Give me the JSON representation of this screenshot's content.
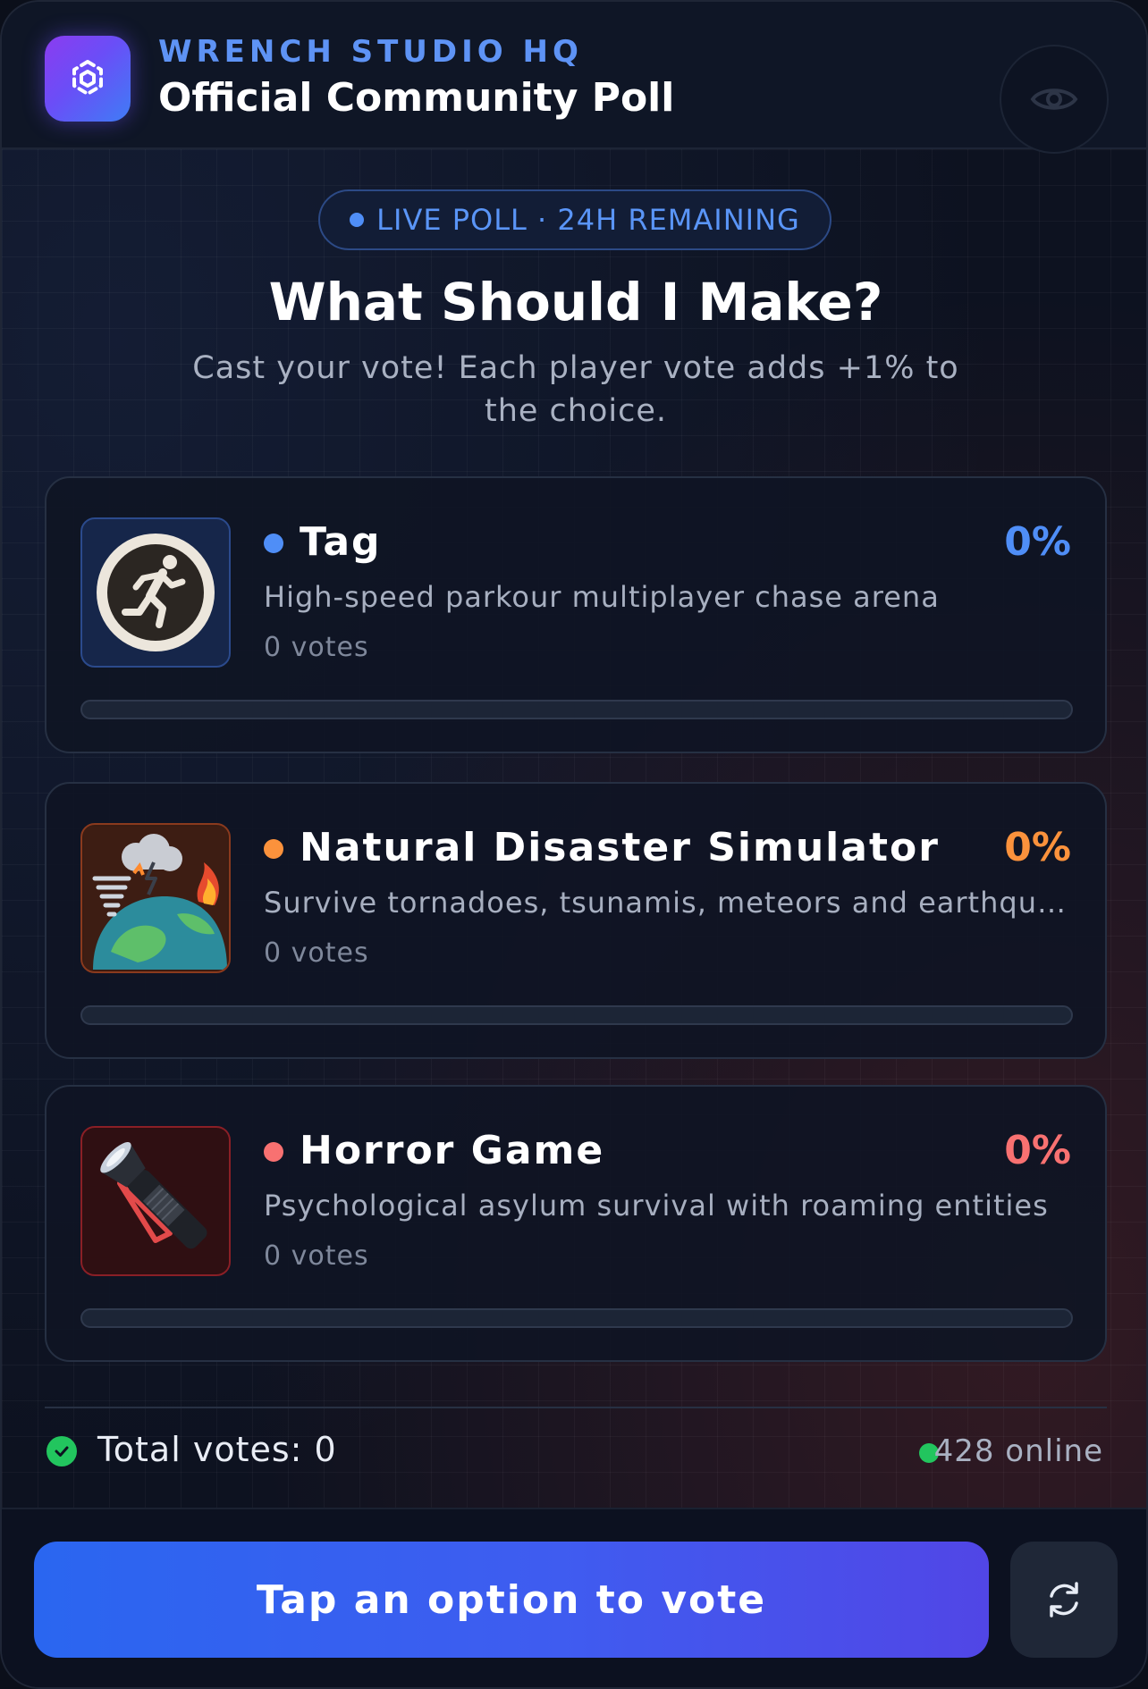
{
  "header": {
    "studio": "WRENCH STUDIO HQ",
    "title": "Official Community Poll",
    "logo_icon": "cube-icon",
    "eye_icon": "eye-icon"
  },
  "badge": {
    "text": "LIVE POLL · 24H REMAINING"
  },
  "heading": "What Should I Make?",
  "subtitle": "Cast your vote! Each player vote adds +1% to the choice.",
  "options": [
    {
      "title": "Tag",
      "description": "High-speed parkour multiplayer chase arena",
      "votes": "0 votes",
      "percent": "0%",
      "fill": 0,
      "accent": "#4f8ef7",
      "icon": "running-man-icon"
    },
    {
      "title": "Natural Disaster Simulator",
      "description": "Survive tornadoes, tsunamis, meteors and earthquakes",
      "votes": "0 votes",
      "percent": "0%",
      "fill": 0,
      "accent": "#fb923c",
      "icon": "disaster-globe-icon"
    },
    {
      "title": "Horror Game",
      "description": "Psychological asylum survival with roaming entities",
      "votes": "0 votes",
      "percent": "0%",
      "fill": 0,
      "accent": "#f87171",
      "icon": "flashlight-icon"
    }
  ],
  "footer": {
    "total_votes": "Total votes: 0",
    "online": "428 online",
    "vote_button": "Tap an option to vote",
    "refresh_icon": "refresh-icon"
  }
}
